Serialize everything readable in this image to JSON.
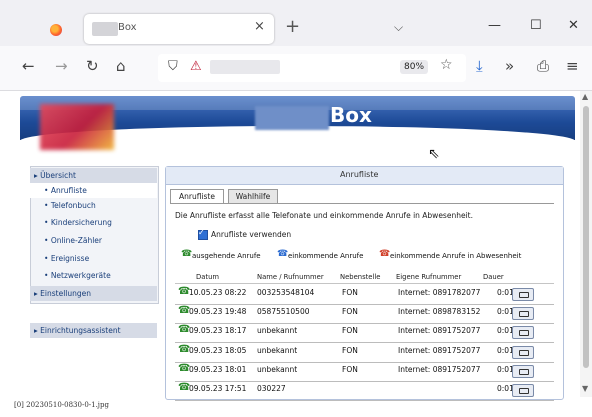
{
  "browser": {
    "tab_title": "Box",
    "tab_close": "×",
    "new_tab": "+",
    "list_tabs": "⌵",
    "minimize": "—",
    "maximize": "☐",
    "close": "✕",
    "back": "←",
    "forward": "→",
    "reload": "↻",
    "home": "⌂",
    "zoom": "80%",
    "bookmark": "☆",
    "download": "⤓",
    "more_tools": "»",
    "extensions": "⎙",
    "menu": "≡"
  },
  "page": {
    "brand": "Box",
    "menu": [
      {
        "label": "Übersicht",
        "level": "top"
      },
      {
        "label": "Anrufliste",
        "level": "sub",
        "selected": true
      },
      {
        "label": "Telefonbuch",
        "level": "sub"
      },
      {
        "label": "Kindersicherung",
        "level": "sub"
      },
      {
        "label": "Online-Zähler",
        "level": "sub"
      },
      {
        "label": "Ereignisse",
        "level": "sub"
      },
      {
        "label": "Netzwerkgeräte",
        "level": "sub"
      },
      {
        "label": "Einstellungen",
        "level": "top"
      },
      {
        "label": "Einrichtungsassistent",
        "level": "top"
      }
    ],
    "panel_title": "Anrufliste",
    "tabs": [
      "Anrufliste",
      "Wahlhilfe"
    ],
    "description": "Die Anrufliste erfasst alle Telefonate und einkommende Anrufe in Abwesenheit.",
    "checkbox_label": "Anrufliste verwenden",
    "legend": [
      "ausgehende Anrufe",
      "einkommende Anrufe",
      "einkommende Anrufe in Abwesenheit"
    ],
    "columns": [
      "Datum",
      "Name / Rufnummer",
      "Nebenstelle",
      "Eigene Rufnummer",
      "Dauer"
    ],
    "rows": [
      {
        "date": "10.05.23 08:22",
        "number": "003253548104",
        "ext": "FON",
        "own": "Internet: 0891782077",
        "dur": "0:01"
      },
      {
        "date": "09.05.23 19:48",
        "number": "05875510500",
        "ext": "FON",
        "own": "Internet: 0898783152",
        "dur": "0:01"
      },
      {
        "date": "09.05.23 18:17",
        "number": "unbekannt",
        "ext": "FON",
        "own": "Internet: 0891752077",
        "dur": "0:01"
      },
      {
        "date": "09.05.23 18:05",
        "number": "unbekannt",
        "ext": "FON",
        "own": "Internet: 0891752077",
        "dur": "0:01"
      },
      {
        "date": "09.05.23 18:01",
        "number": "unbekannt",
        "ext": "FON",
        "own": "Internet: 0891752077",
        "dur": "0:01"
      },
      {
        "date": "09.05.23 17:51",
        "number": "030227",
        "ext": "",
        "own": "",
        "dur": "0:01"
      }
    ]
  },
  "caption": "[0] 20230510-0830-0-1.jpg"
}
